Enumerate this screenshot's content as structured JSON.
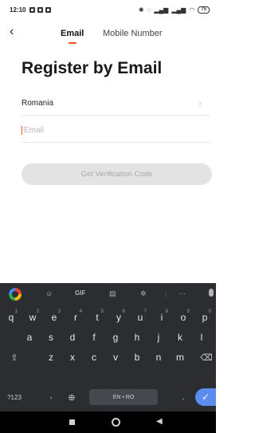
{
  "status_bar": {
    "time": "12:10",
    "battery": "75"
  },
  "nav": {
    "back_icon": "chevron-left-icon",
    "tabs": [
      {
        "label": "Email",
        "active": true
      },
      {
        "label": "Mobile Number",
        "active": false
      }
    ],
    "accent_color": "#ff4d1c"
  },
  "page": {
    "title": "Register by Email",
    "country": "Romania",
    "email_placeholder": "Email",
    "verify_button": "Get Verification Code"
  },
  "keyboard": {
    "toolbar": [
      "GIF"
    ],
    "row1": [
      {
        "k": "q",
        "n": "1"
      },
      {
        "k": "w",
        "n": "2"
      },
      {
        "k": "e",
        "n": "3"
      },
      {
        "k": "r",
        "n": "4"
      },
      {
        "k": "t",
        "n": "5"
      },
      {
        "k": "y",
        "n": "6"
      },
      {
        "k": "u",
        "n": "7"
      },
      {
        "k": "i",
        "n": "8"
      },
      {
        "k": "o",
        "n": "9"
      },
      {
        "k": "p",
        "n": "0"
      }
    ],
    "row2": [
      "a",
      "s",
      "d",
      "f",
      "g",
      "h",
      "j",
      "k",
      "l"
    ],
    "row3": [
      "z",
      "x",
      "c",
      "v",
      "b",
      "n",
      "m"
    ],
    "symbols_key": "?123",
    "comma_key": ",",
    "space_label": "EN • RO",
    "period_key": "."
  }
}
